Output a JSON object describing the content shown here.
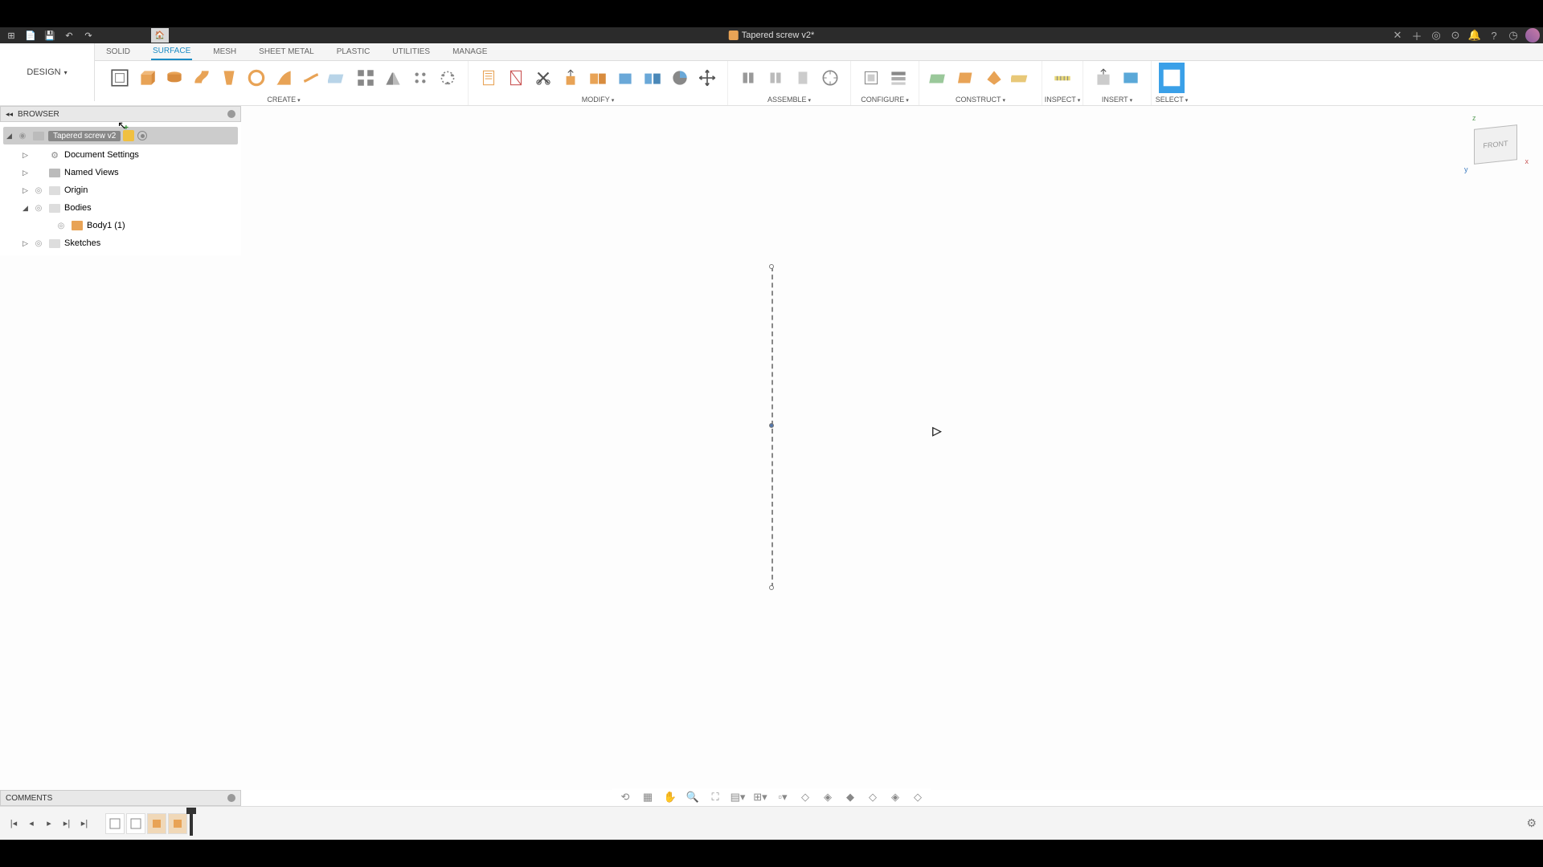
{
  "title": "Tapered screw v2*",
  "workspace": "DESIGN",
  "tabs": [
    "SOLID",
    "SURFACE",
    "MESH",
    "SHEET METAL",
    "PLASTIC",
    "UTILITIES",
    "MANAGE"
  ],
  "active_tab": 1,
  "toolbar_groups": {
    "create": "CREATE",
    "modify": "MODIFY",
    "assemble": "ASSEMBLE",
    "configure": "CONFIGURE",
    "construct": "CONSTRUCT",
    "inspect": "INSPECT",
    "insert": "INSERT",
    "select": "SELECT"
  },
  "browser": {
    "title": "BROWSER",
    "root": "Tapered screw v2",
    "items": [
      {
        "label": "Document Settings",
        "icon": "gear"
      },
      {
        "label": "Named Views",
        "icon": "folder"
      },
      {
        "label": "Origin",
        "icon": "folder-light"
      },
      {
        "label": "Bodies",
        "icon": "folder-light",
        "expanded": true
      },
      {
        "label": "Body1 (1)",
        "icon": "body",
        "indent": 2
      },
      {
        "label": "Sketches",
        "icon": "folder-light"
      }
    ]
  },
  "comments": {
    "title": "COMMENTS"
  },
  "viewcube": {
    "face": "FRONT",
    "axes": {
      "z": "z",
      "y": "y",
      "x": "x"
    }
  }
}
